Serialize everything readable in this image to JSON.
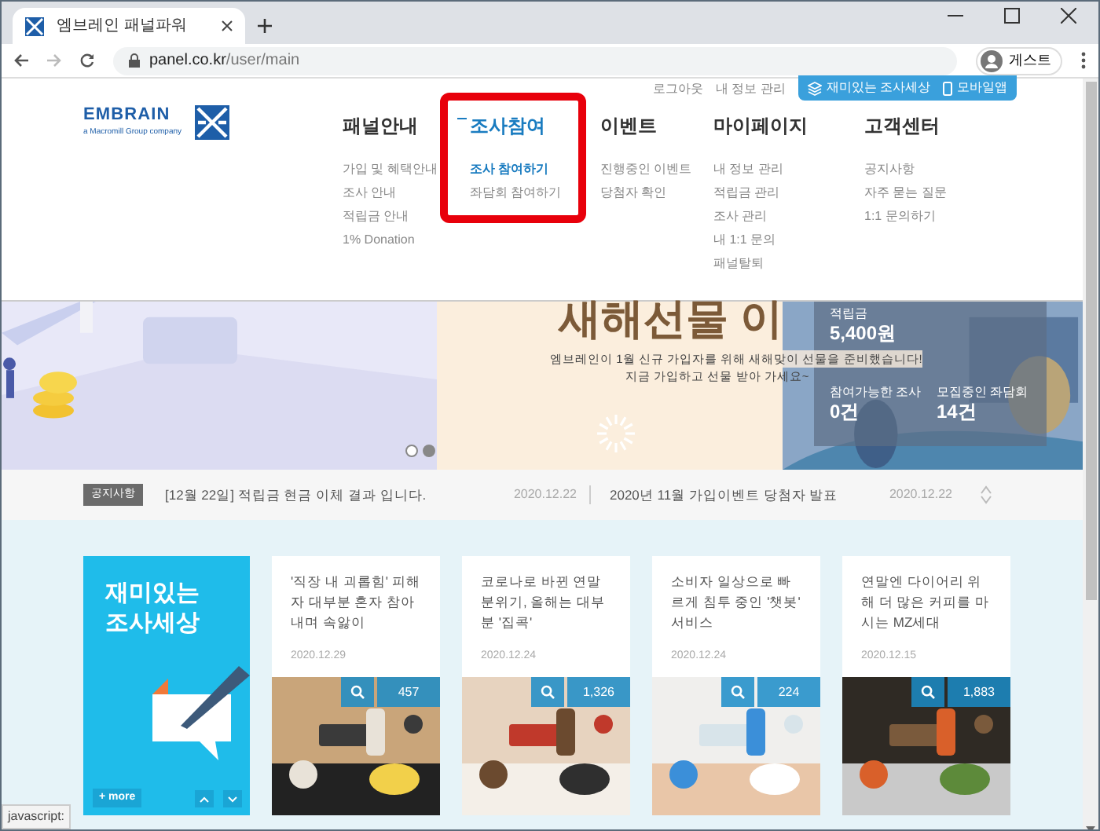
{
  "browser": {
    "tab_title": "엠브레인 패널파워",
    "url_host": "panel.co.kr",
    "url_path": "/user/main",
    "profile": "게스트"
  },
  "header": {
    "links": [
      "로그아웃",
      "내 정보 관리"
    ],
    "buttons": [
      {
        "kind": "layers",
        "label": "재미있는 조사세상"
      },
      {
        "kind": "phone",
        "label": "모바일앱"
      }
    ],
    "logo": {
      "name": "EMBRAIN",
      "tagline": "a Macromill Group company"
    }
  },
  "nav": [
    {
      "title": "패널안내",
      "selected": false,
      "highlighted": false,
      "items": [
        {
          "label": "가입 및 혜택안내",
          "selected": false
        },
        {
          "label": "조사 안내",
          "selected": false
        },
        {
          "label": "적립금 안내",
          "selected": false
        },
        {
          "label": "1% Donation",
          "selected": false
        }
      ]
    },
    {
      "title": "조사참여",
      "selected": true,
      "highlighted": true,
      "items": [
        {
          "label": "조사 참여하기",
          "selected": true
        },
        {
          "label": "좌담회 참여하기",
          "selected": false
        }
      ]
    },
    {
      "title": "이벤트",
      "selected": false,
      "highlighted": false,
      "items": [
        {
          "label": "진행중인 이벤트",
          "selected": false
        },
        {
          "label": "당첨자 확인",
          "selected": false
        }
      ]
    },
    {
      "title": "마이페이지",
      "selected": false,
      "highlighted": false,
      "items": [
        {
          "label": "내 정보 관리",
          "selected": false
        },
        {
          "label": "적립금 관리",
          "selected": false
        },
        {
          "label": "조사 관리",
          "selected": false
        },
        {
          "label": "내 1:1 문의",
          "selected": false
        },
        {
          "label": "패널탈퇴",
          "selected": false
        }
      ]
    },
    {
      "title": "고객센터",
      "selected": false,
      "highlighted": false,
      "items": [
        {
          "label": "공지사항",
          "selected": false
        },
        {
          "label": "자주 묻는 질문",
          "selected": false
        },
        {
          "label": "1:1 문의하기",
          "selected": false
        }
      ]
    }
  ],
  "banner": {
    "title": "새해선물 이",
    "lines": [
      "엠브레인이 1월 신규 가입자를 위해 새해맞이 선물을 준비했습니다!",
      "지금 가입하고 선물 받아 가세요~"
    ],
    "stats": [
      {
        "label": "적립금",
        "value": "5,400원"
      },
      {
        "label": "참여가능한 조사",
        "value": "0건"
      },
      {
        "label": "모집중인 좌담회",
        "value": "14건"
      }
    ],
    "dots": [
      {
        "selected": false
      },
      {
        "selected": true
      }
    ]
  },
  "notices": {
    "badge": "공지사항",
    "items": [
      {
        "text": "[12월 22일] 적립금 현금 이체 결과 입니다.",
        "date": "2020.12.22"
      },
      {
        "text": "2020년 11월 가입이벤트 당첨자 발표",
        "date": "2020.12.22"
      }
    ]
  },
  "promo": {
    "lines": [
      "재미있는",
      "조사세상"
    ],
    "more": "+ more"
  },
  "articles": [
    {
      "title": "'직장 내 괴롭힘' 피해자 대부분 혼자 참아내며 속앓이",
      "date": "2020.12.29",
      "views": "457"
    },
    {
      "title": "코로나로 바뀐 연말 분위기, 올해는 대부분 '집콕'",
      "date": "2020.12.24",
      "views": "1,326"
    },
    {
      "title": "소비자 일상으로 빠르게 침투 중인 '챗봇' 서비스",
      "date": "2020.12.24",
      "views": "224"
    },
    {
      "title": "연말엔 다이어리 위해 더 많은 커피를 마시는 MZ세대",
      "date": "2020.12.15",
      "views": "1,883"
    }
  ],
  "status_bar": "javascript:"
}
